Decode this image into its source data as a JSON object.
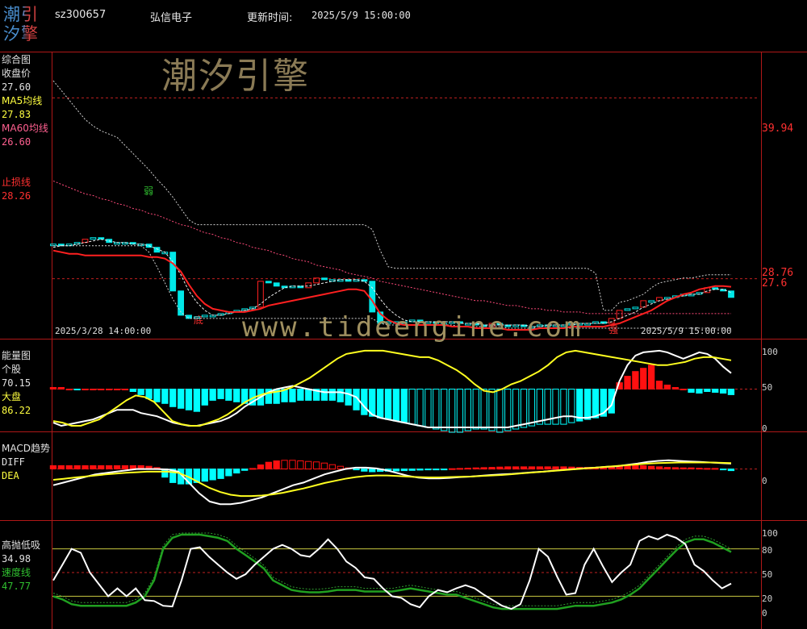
{
  "logo": {
    "text_top": "潮引",
    "text_bottom": "汐擎"
  },
  "header": {
    "code": "sz300657",
    "name": "弘信电子",
    "update_label": "更新时间:",
    "update_time": "2025/5/9 15:00:00"
  },
  "watermark": {
    "brand": "潮汐引擎",
    "url": "www.tideengine.com"
  },
  "colors": {
    "up": "#ff2020",
    "down": "#00ffff",
    "ma5": "#ffff00",
    "ma60": "#ff4080",
    "stop": "#ff2020",
    "grid": "#b01818"
  },
  "chart_data": [
    {
      "type": "line",
      "panel": "综合图",
      "labels": [
        "综合图",
        "收盘价",
        "27.60",
        "MA5均线",
        "27.83",
        "MA60均线",
        "26.60",
        "止损线",
        "28.26"
      ],
      "right_ticks": [
        "39.94",
        "28.76",
        "27.6"
      ],
      "x_start": "2025/3/28 14:00:00",
      "x_end": "2025/5/9 15:00:00",
      "annotations": [
        "弱",
        "底",
        "强"
      ],
      "ylim": [
        25.3,
        42.5
      ],
      "ref_lines": [
        39.94,
        28.76,
        26.3
      ],
      "close": [
        30.9,
        30.8,
        30.9,
        31.0,
        31.2,
        31.3,
        31.2,
        31.0,
        31.0,
        31.0,
        30.9,
        30.9,
        30.7,
        30.4,
        30.4,
        28.0,
        26.5,
        26.3,
        26.4,
        26.5,
        26.5,
        26.6,
        26.7,
        26.8,
        26.9,
        27.0,
        28.6,
        28.5,
        28.3,
        28.2,
        28.3,
        28.2,
        28.5,
        28.8,
        28.7,
        28.7,
        28.7,
        28.6,
        28.7,
        28.6,
        26.7,
        26.0,
        26.1,
        26.1,
        26.1,
        26.2,
        26.1,
        26.1,
        26.0,
        26.0,
        26.1,
        26.0,
        26.0,
        25.9,
        25.8,
        26.0,
        25.9,
        25.8,
        25.9,
        25.8,
        25.8,
        25.9,
        25.9,
        25.9,
        25.9,
        26.0,
        26.0,
        26.0,
        26.1,
        26.0,
        26.3,
        26.8,
        26.9,
        27.0,
        27.4,
        27.4,
        27.6,
        27.6,
        27.7,
        27.8,
        27.8,
        27.9,
        28.2,
        28.1,
        28.0,
        27.6
      ],
      "ma5": [
        30.7,
        30.8,
        30.8,
        30.9,
        31.0,
        31.1,
        31.2,
        31.1,
        31.0,
        31.0,
        30.9,
        30.9,
        30.8,
        30.6,
        30.4,
        29.8,
        29.0,
        28.0,
        27.3,
        26.8,
        26.5,
        26.5,
        26.6,
        26.7,
        26.8,
        26.9,
        27.2,
        27.6,
        27.9,
        28.2,
        28.3,
        28.3,
        28.3,
        28.4,
        28.5,
        28.6,
        28.7,
        28.7,
        28.7,
        28.6,
        28.2,
        27.5,
        26.9,
        26.5,
        26.2,
        26.1,
        26.1,
        26.1,
        26.1,
        26.1,
        26.1,
        26.0,
        26.0,
        26.0,
        25.9,
        25.9,
        25.9,
        25.9,
        25.9,
        25.9,
        25.8,
        25.8,
        25.9,
        25.9,
        25.9,
        25.9,
        26.0,
        26.0,
        26.0,
        26.0,
        26.1,
        26.3,
        26.5,
        26.7,
        27.0,
        27.2,
        27.4,
        27.5,
        27.6,
        27.7,
        27.8,
        27.8,
        28.0,
        28.1,
        28.1,
        27.9
      ],
      "ma60": [
        34.8,
        34.6,
        34.4,
        34.2,
        34.0,
        33.9,
        33.7,
        33.6,
        33.4,
        33.3,
        33.1,
        33.0,
        32.8,
        32.7,
        32.5,
        32.3,
        32.1,
        32.0,
        31.8,
        31.6,
        31.5,
        31.3,
        31.2,
        31.0,
        30.9,
        30.7,
        30.6,
        30.5,
        30.3,
        30.2,
        30.0,
        29.9,
        29.8,
        29.6,
        29.5,
        29.4,
        29.3,
        29.1,
        29.0,
        28.9,
        28.8,
        28.6,
        28.5,
        28.4,
        28.3,
        28.2,
        28.1,
        28.0,
        27.9,
        27.8,
        27.7,
        27.6,
        27.5,
        27.4,
        27.4,
        27.3,
        27.2,
        27.1,
        27.1,
        27.0,
        26.9,
        26.9,
        26.8,
        26.8,
        26.7,
        26.7,
        26.7,
        26.6,
        26.6,
        26.6,
        26.6,
        26.6,
        26.6,
        26.6,
        26.6,
        26.6,
        26.6,
        26.6,
        26.6,
        26.6,
        26.6,
        26.6,
        26.6,
        26.6,
        26.6,
        26.6
      ],
      "stop": [
        30.5,
        30.4,
        30.3,
        30.3,
        30.2,
        30.2,
        30.2,
        30.2,
        30.2,
        30.2,
        30.2,
        30.2,
        30.1,
        30.1,
        30.0,
        29.7,
        29.2,
        28.4,
        27.7,
        27.2,
        26.9,
        26.8,
        26.7,
        26.7,
        26.7,
        26.8,
        26.9,
        27.1,
        27.2,
        27.3,
        27.4,
        27.5,
        27.6,
        27.7,
        27.8,
        27.9,
        28.0,
        28.1,
        28.1,
        28.0,
        27.4,
        26.6,
        26.2,
        26.0,
        25.9,
        25.9,
        25.9,
        25.9,
        25.9,
        25.9,
        25.8,
        25.8,
        25.8,
        25.7,
        25.7,
        25.7,
        25.7,
        25.6,
        25.6,
        25.6,
        25.6,
        25.7,
        25.7,
        25.7,
        25.7,
        25.8,
        25.8,
        25.8,
        25.8,
        25.8,
        25.9,
        26.0,
        26.2,
        26.4,
        26.6,
        26.8,
        27.1,
        27.4,
        27.6,
        27.8,
        27.9,
        28.1,
        28.2,
        28.3,
        28.3,
        28.26
      ],
      "upper": [
        41.0,
        40.4,
        39.8,
        39.2,
        38.6,
        38.2,
        37.9,
        37.7,
        37.5,
        37.0,
        36.5,
        36.0,
        35.5,
        34.9,
        34.4,
        33.8,
        33.1,
        32.4,
        32.1,
        32.1,
        32.1,
        32.1,
        32.1,
        32.1,
        32.1,
        32.1,
        32.1,
        32.1,
        32.1,
        32.1,
        32.1,
        32.1,
        32.1,
        32.1,
        32.1,
        32.1,
        32.1,
        32.1,
        32.1,
        32.1,
        31.8,
        30.5,
        29.5,
        29.4,
        29.4,
        29.4,
        29.4,
        29.4,
        29.4,
        29.4,
        29.4,
        29.4,
        29.4,
        29.4,
        29.4,
        29.4,
        29.4,
        29.4,
        29.4,
        29.4,
        29.4,
        29.4,
        29.4,
        29.4,
        29.4,
        29.4,
        29.4,
        29.4,
        29.1,
        26.8,
        26.8,
        27.3,
        27.4,
        27.6,
        27.8,
        28.2,
        28.5,
        28.6,
        28.7,
        28.8,
        28.8,
        28.9,
        29.0,
        29.0,
        29.0,
        29.0
      ],
      "lower": [
        30.8,
        30.8,
        30.8,
        30.8,
        30.8,
        30.8,
        30.8,
        30.8,
        30.8,
        30.8,
        30.8,
        30.8,
        30.4,
        29.5,
        28.5,
        27.5,
        26.7,
        26.3,
        26.3,
        26.3,
        26.3,
        26.3,
        26.3,
        26.3,
        26.3,
        26.3,
        26.3,
        26.3,
        26.3,
        26.3,
        26.3,
        26.3,
        26.3,
        26.3,
        26.3,
        26.3,
        26.3,
        26.3,
        26.3,
        26.3,
        26.3,
        26.0,
        25.9,
        25.9,
        25.9,
        25.9,
        25.9,
        25.9,
        25.9,
        25.9,
        25.9,
        25.8,
        25.8,
        25.8,
        25.8,
        25.8,
        25.8,
        25.7,
        25.7,
        25.7,
        25.7,
        25.7,
        25.7,
        25.7,
        25.7,
        25.7,
        25.7,
        25.7,
        25.7,
        25.7,
        25.7,
        25.7,
        25.7,
        25.7,
        25.7,
        25.7,
        25.7,
        25.7,
        25.7,
        25.7,
        25.7,
        25.7,
        25.7,
        25.7,
        25.7,
        25.7
      ]
    },
    {
      "type": "bar",
      "panel": "能量图",
      "labels": [
        "能量图",
        "个股",
        "70.15",
        "大盘",
        "86.22"
      ],
      "right_ticks": [
        "100",
        "50",
        "0"
      ],
      "ylim": [
        0,
        105
      ],
      "ref_lines": [
        50,
        0
      ],
      "bars": [
        2,
        2,
        0,
        -1,
        0,
        0,
        0,
        0,
        0,
        0,
        -3,
        -7,
        -12,
        -16,
        -18,
        -22,
        -24,
        -26,
        -28,
        -20,
        -14,
        -12,
        -14,
        -16,
        -18,
        -20,
        -20,
        -18,
        -18,
        -16,
        -16,
        -14,
        -14,
        -14,
        -14,
        -14,
        -16,
        -20,
        -26,
        -32,
        -34,
        -36,
        -38,
        -40,
        -42,
        -44,
        -46,
        -48,
        -50,
        -52,
        -54,
        -54,
        -52,
        -50,
        -50,
        -52,
        -54,
        -52,
        -50,
        -48,
        -46,
        -44,
        -44,
        -44,
        -44,
        -42,
        -40,
        -38,
        -36,
        -34,
        -30,
        8,
        16,
        22,
        26,
        30,
        10,
        5,
        2,
        0,
        -4,
        -5,
        -3,
        -4,
        -5,
        -7
      ],
      "gerenguo": [
        8,
        4,
        6,
        8,
        10,
        12,
        16,
        20,
        24,
        24,
        24,
        20,
        18,
        16,
        12,
        8,
        6,
        4,
        4,
        6,
        8,
        10,
        14,
        20,
        28,
        34,
        40,
        46,
        50,
        52,
        54,
        52,
        50,
        48,
        46,
        46,
        46,
        44,
        40,
        28,
        18,
        14,
        12,
        10,
        8,
        6,
        4,
        2,
        2,
        2,
        2,
        2,
        2,
        2,
        2,
        2,
        2,
        2,
        4,
        6,
        8,
        10,
        12,
        14,
        16,
        16,
        14,
        14,
        16,
        20,
        30,
        60,
        80,
        92,
        96,
        97,
        98,
        96,
        92,
        88,
        92,
        96,
        94,
        88,
        78,
        70
      ],
      "dapan": [
        10,
        8,
        4,
        4,
        8,
        12,
        20,
        28,
        36,
        42,
        40,
        34,
        22,
        10,
        6,
        4,
        4,
        8,
        12,
        18,
        26,
        34,
        40,
        44,
        46,
        48,
        52,
        58,
        64,
        72,
        80,
        88,
        94,
        96,
        98,
        98,
        98,
        96,
        94,
        92,
        90,
        90,
        86,
        80,
        74,
        66,
        56,
        48,
        46,
        50,
        56,
        60,
        66,
        72,
        80,
        90,
        96,
        98,
        96,
        94,
        92,
        90,
        88,
        86,
        84,
        82,
        80,
        80,
        82,
        84,
        88,
        90,
        90,
        88,
        86
      ]
    },
    {
      "type": "bar",
      "panel": "MACD趋势",
      "labels": [
        "MACD趋势",
        "DIFF",
        "DEA"
      ],
      "right_ticks": [
        "0"
      ],
      "ylim": [
        -1.8,
        1.0
      ],
      "ref_lines": [
        0
      ],
      "bars": [
        0.12,
        0.12,
        0.12,
        0.12,
        0.12,
        0.12,
        0.12,
        0.12,
        0.12,
        0.12,
        0.12,
        0.12,
        0.1,
        0.05,
        -0.3,
        -0.5,
        -0.55,
        -0.55,
        -0.5,
        -0.45,
        -0.4,
        -0.35,
        -0.25,
        -0.15,
        -0.05,
        0.02,
        0.15,
        0.25,
        0.3,
        0.32,
        0.32,
        0.3,
        0.28,
        0.26,
        0.22,
        0.16,
        0.1,
        0.04,
        -0.02,
        -0.08,
        -0.1,
        -0.09,
        -0.08,
        -0.07,
        -0.06,
        -0.05,
        -0.04,
        -0.03,
        -0.02,
        -0.01,
        0.01,
        0.02,
        0.03,
        0.04,
        0.05,
        0.06,
        0.07,
        0.08,
        0.08,
        0.08,
        0.08,
        0.08,
        0.08,
        0.08,
        0.08,
        0.07,
        0.06,
        0.06,
        0.06,
        0.06,
        0.08,
        0.1,
        0.12,
        0.14,
        0.12,
        0.1,
        0.08,
        0.06,
        0.05,
        0.04,
        0.04,
        0.03,
        0.02,
        0.02,
        -0.03,
        -0.06
      ],
      "diff": [
        -0.6,
        -0.5,
        -0.4,
        -0.3,
        -0.2,
        -0.15,
        -0.1,
        -0.05,
        0.0,
        0.0,
        0.0,
        -0.02,
        -0.1,
        -0.5,
        -0.9,
        -1.2,
        -1.3,
        -1.3,
        -1.25,
        -1.15,
        -1.05,
        -0.9,
        -0.75,
        -0.6,
        -0.5,
        -0.35,
        -0.2,
        -0.1,
        0.0,
        0.05,
        0.05,
        0.02,
        -0.05,
        -0.15,
        -0.25,
        -0.32,
        -0.35,
        -0.35,
        -0.33,
        -0.3,
        -0.28,
        -0.25,
        -0.22,
        -0.2,
        -0.18,
        -0.15,
        -0.12,
        -0.1,
        -0.06,
        -0.03,
        0.0,
        0.03,
        0.05,
        0.08,
        0.1,
        0.15,
        0.2,
        0.26,
        0.3,
        0.32,
        0.3,
        0.28,
        0.26,
        0.24,
        0.22,
        0.2
      ],
      "dea": [
        -0.4,
        -0.36,
        -0.32,
        -0.28,
        -0.24,
        -0.2,
        -0.17,
        -0.14,
        -0.12,
        -0.1,
        -0.1,
        -0.1,
        -0.14,
        -0.3,
        -0.5,
        -0.7,
        -0.85,
        -0.95,
        -1.0,
        -1.0,
        -0.98,
        -0.94,
        -0.88,
        -0.8,
        -0.72,
        -0.62,
        -0.52,
        -0.44,
        -0.36,
        -0.3,
        -0.26,
        -0.24,
        -0.24,
        -0.26,
        -0.28,
        -0.3,
        -0.31,
        -0.31,
        -0.3,
        -0.29,
        -0.28,
        -0.26,
        -0.24,
        -0.22,
        -0.19,
        -0.16,
        -0.13,
        -0.1,
        -0.07,
        -0.04,
        -0.01,
        0.02,
        0.05,
        0.08,
        0.11,
        0.14,
        0.17,
        0.2,
        0.22,
        0.23,
        0.24,
        0.24,
        0.24,
        0.24,
        0.23,
        0.22
      ]
    },
    {
      "type": "line",
      "panel": "高抛低吸",
      "labels": [
        "高抛低吸",
        "34.98",
        "速度线",
        "47.77"
      ],
      "right_ticks": [
        "100",
        "80",
        "50",
        "20",
        "0"
      ],
      "ylim": [
        0,
        100
      ],
      "ref_lines": [
        80,
        50,
        20
      ],
      "white": [
        40,
        60,
        80,
        75,
        50,
        35,
        20,
        30,
        20,
        30,
        15,
        14,
        8,
        7,
        40,
        80,
        82,
        70,
        60,
        50,
        42,
        48,
        60,
        70,
        80,
        85,
        80,
        72,
        70,
        80,
        92,
        80,
        64,
        56,
        44,
        42,
        30,
        20,
        18,
        10,
        6,
        20,
        28,
        25,
        30,
        34,
        30,
        22,
        15,
        8,
        4,
        10,
        40,
        80,
        70,
        45,
        22,
        24,
        60,
        80,
        58,
        38,
        50,
        60,
        90,
        96,
        92,
        98,
        94,
        86,
        60,
        52,
        40,
        30,
        36
      ],
      "green": [
        20,
        16,
        10,
        8,
        8,
        8,
        8,
        8,
        8,
        12,
        20,
        40,
        80,
        94,
        98,
        98,
        98,
        96,
        94,
        90,
        80,
        72,
        64,
        55,
        40,
        34,
        28,
        26,
        25,
        25,
        26,
        28,
        28,
        28,
        26,
        26,
        26,
        26,
        28,
        30,
        28,
        26,
        24,
        22,
        22,
        18,
        14,
        10,
        6,
        4,
        4,
        4,
        4,
        4,
        4,
        4,
        6,
        8,
        8,
        8,
        10,
        12,
        16,
        22,
        30,
        42,
        54,
        66,
        78,
        88,
        92,
        92,
        88,
        82,
        76
      ]
    }
  ]
}
